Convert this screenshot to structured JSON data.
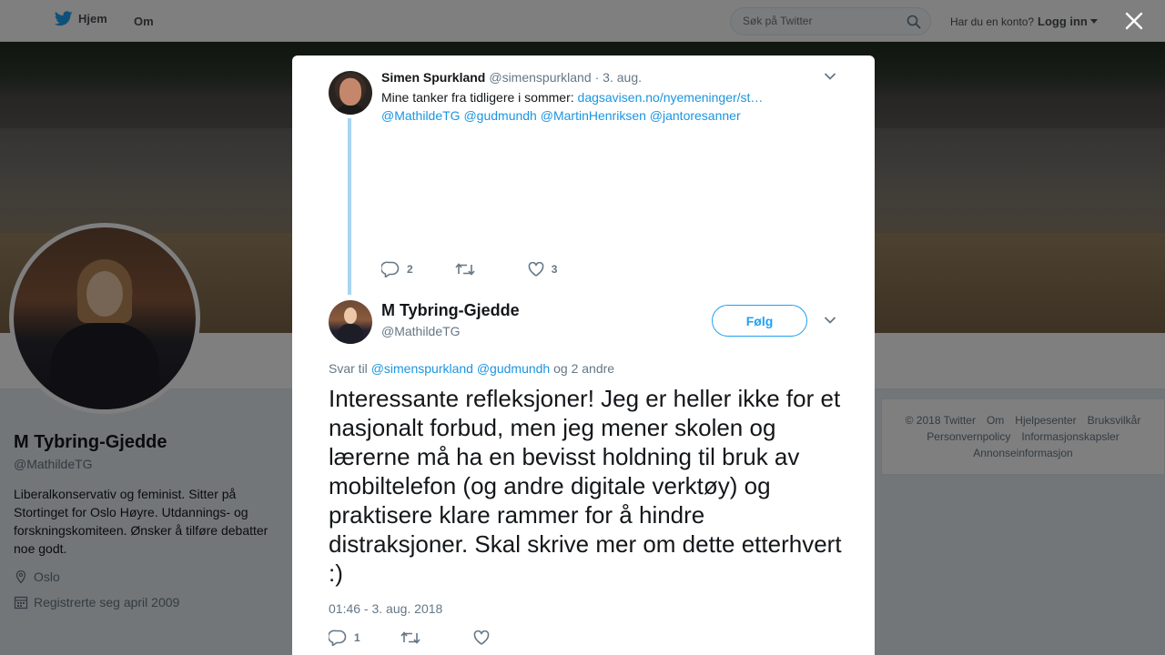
{
  "nav": {
    "home_label": "Hjem",
    "about_label": "Om",
    "search_placeholder": "Søk på Twitter",
    "account_question": "Har du en konto?",
    "login_label": "Logg inn"
  },
  "profile": {
    "name": "M Tybring-Gjedde",
    "handle": "@MathildeTG",
    "bio": "Liberalkonservativ og feminist. Sitter på Stortinget for Oslo Høyre. Utdannings- og forskningskomiteen. Ønsker å tilføre debatter noe godt.",
    "location": "Oslo",
    "joined": "Registrerte seg april 2009"
  },
  "footer": {
    "row1": [
      "© 2018 Twitter",
      "Om",
      "Hjelpesenter",
      "Bruksvilkår"
    ],
    "row2": [
      "Personvernpolicy",
      "Informasjonskapsler"
    ],
    "row3": [
      "Annonseinformasjon"
    ]
  },
  "parent_tweet": {
    "name": "Simen Spurkland",
    "handle": "@simenspurkland",
    "date": "· 3. aug.",
    "text_prefix": "Mine tanker fra tidligere i sommer:",
    "link": "dagsavisen.no/nyemeninger/st…",
    "mentions": [
      "@MathildeTG",
      "@gudmundh",
      "@MartinHenriksen",
      "@jantoresanner"
    ],
    "reply_count": "2",
    "like_count": "3"
  },
  "main_tweet": {
    "name": "M Tybring-Gjedde",
    "handle": "@MathildeTG",
    "follow_label": "Følg",
    "reply_prefix": "Svar til",
    "reply_mentions": [
      "@simenspurkland",
      "@gudmundh"
    ],
    "reply_suffix": "og 2 andre",
    "text": "Interessante refleksjoner! Jeg er heller ikke for et nasjonalt forbud, men jeg mener skolen og lærerne må ha en bevisst holdning til bruk av mobiltelefon (og andre digitale verktøy) og praktisere klare rammer for å hindre distraksjoner. Skal skrive mer om dette etterhvert :)",
    "timestamp": "01:46 - 3. aug. 2018",
    "reply_count": "1"
  },
  "colors": {
    "accent": "#1da1f2",
    "link": "#1b95e0",
    "muted": "#657786",
    "thread_line": "#a9d5f1"
  },
  "icons": [
    "twitter-bird-icon",
    "search-icon",
    "caret-down-icon",
    "close-icon",
    "chevron-down-icon",
    "reply-icon",
    "retweet-icon",
    "heart-icon",
    "location-icon",
    "calendar-icon"
  ]
}
